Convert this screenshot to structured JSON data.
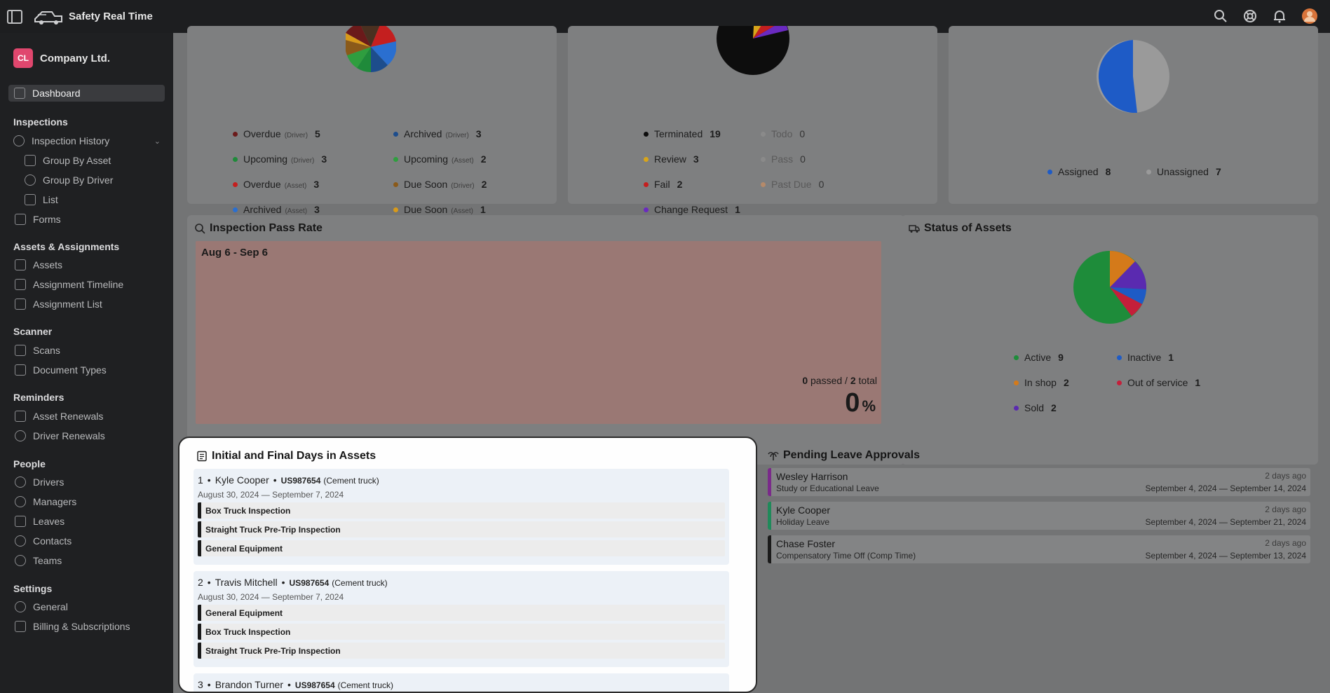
{
  "app": {
    "title": "Safety Real Time"
  },
  "company": {
    "initials": "CL",
    "name": "Company Ltd."
  },
  "sidebar": {
    "dashboard": "Dashboard",
    "inspections_header": "Inspections",
    "inspection_history": "Inspection History",
    "group_by_asset": "Group By Asset",
    "group_by_driver": "Group By Driver",
    "list": "List",
    "forms": "Forms",
    "assets_header": "Assets & Assignments",
    "assets": "Assets",
    "assignment_timeline": "Assignment Timeline",
    "assignment_list": "Assignment List",
    "scanner_header": "Scanner",
    "scans": "Scans",
    "document_types": "Document Types",
    "reminders_header": "Reminders",
    "asset_renewals": "Asset Renewals",
    "driver_renewals": "Driver Renewals",
    "people_header": "People",
    "drivers": "Drivers",
    "managers": "Managers",
    "leaves": "Leaves",
    "contacts": "Contacts",
    "teams": "Teams",
    "settings_header": "Settings",
    "general": "General",
    "billing": "Billing & Subscriptions"
  },
  "inspections_card": {
    "legend": [
      {
        "label": "Overdue",
        "qual": "(Driver)",
        "count": "5",
        "color": "#6b1a1a"
      },
      {
        "label": "Archived",
        "qual": "(Driver)",
        "count": "3",
        "color": "#1d4d8c"
      },
      {
        "label": "Upcoming",
        "qual": "(Driver)",
        "count": "3",
        "color": "#1f8a3a"
      },
      {
        "label": "Upcoming",
        "qual": "(Asset)",
        "count": "2",
        "color": "#2f9e3f"
      },
      {
        "label": "Overdue",
        "qual": "(Asset)",
        "count": "3",
        "color": "#c41f1f"
      },
      {
        "label": "Due Soon",
        "qual": "(Driver)",
        "count": "2",
        "color": "#8a5a1a"
      },
      {
        "label": "Archived",
        "qual": "(Asset)",
        "count": "3",
        "color": "#2a6fd0"
      },
      {
        "label": "Due Soon",
        "qual": "(Asset)",
        "count": "1",
        "color": "#d89a1a"
      }
    ]
  },
  "status_card": {
    "legend": [
      {
        "label": "Terminated",
        "count": "19",
        "color": "#0d0d0d"
      },
      {
        "label": "Todo",
        "count": "0",
        "color": "#8a8a8a"
      },
      {
        "label": "Review",
        "count": "3",
        "color": "#d8a51a"
      },
      {
        "label": "Pass",
        "count": "0",
        "color": "#8a8a8a"
      },
      {
        "label": "Fail",
        "count": "2",
        "color": "#c41f1f"
      },
      {
        "label": "Past Due",
        "count": "0",
        "color": "#b58a6a"
      },
      {
        "label": "Change Request",
        "count": "1",
        "color": "#6a2ac0"
      }
    ]
  },
  "assignment_card": {
    "legend": [
      {
        "label": "Assigned",
        "count": "8",
        "color": "#1e5bc6"
      },
      {
        "label": "Unassigned",
        "count": "7",
        "color": "#9a9a9a"
      }
    ]
  },
  "pass_rate": {
    "title": "Inspection Pass Rate",
    "range": "Aug 6 - Sep 6",
    "passed": "0",
    "passed_label": "passed /",
    "total": "2",
    "total_label": "total",
    "percent": "0",
    "percent_sign": "%"
  },
  "asset_status": {
    "title": "Status of Assets",
    "legend": [
      {
        "label": "Active",
        "count": "9",
        "color": "#1e8c3a"
      },
      {
        "label": "Inactive",
        "count": "1",
        "color": "#1e5bc6"
      },
      {
        "label": "In shop",
        "count": "2",
        "color": "#d47a1a"
      },
      {
        "label": "Out of service",
        "count": "1",
        "color": "#c41f3a"
      },
      {
        "label": "Sold",
        "count": "2",
        "color": "#5a2ab0"
      }
    ]
  },
  "initial_final": {
    "title": "Initial and Final Days in Assets",
    "entries": [
      {
        "index": "1",
        "name": "Kyle Cooper",
        "code": "US987654",
        "type": "(Cement truck)",
        "dates": "August 30, 2024 — September 7, 2024",
        "inspections": [
          "Box Truck Inspection",
          "Straight Truck Pre-Trip Inspection",
          "General Equipment"
        ]
      },
      {
        "index": "2",
        "name": "Travis Mitchell",
        "code": "US987654",
        "type": "(Cement truck)",
        "dates": "August 30, 2024 — September 7, 2024",
        "inspections": [
          "General Equipment",
          "Box Truck Inspection",
          "Straight Truck Pre-Trip Inspection"
        ]
      },
      {
        "index": "3",
        "name": "Brandon Turner",
        "code": "US987654",
        "type": "(Cement truck)"
      }
    ]
  },
  "pending_leave": {
    "title": "Pending Leave Approvals",
    "rows": [
      {
        "name": "Wesley Harrison",
        "type": "Study or Educational Leave",
        "ago": "2 days ago",
        "range": "September 4, 2024 — September 14, 2024",
        "color": "#7a2a8a"
      },
      {
        "name": "Kyle Cooper",
        "type": "Holiday Leave",
        "ago": "2 days ago",
        "range": "September 4, 2024 — September 21, 2024",
        "color": "#1f8a5a"
      },
      {
        "name": "Chase Foster",
        "type": "Compensatory Time Off (Comp Time)",
        "ago": "2 days ago",
        "range": "September 4, 2024 — September 13, 2024",
        "color": "#1a1a1a"
      }
    ]
  }
}
